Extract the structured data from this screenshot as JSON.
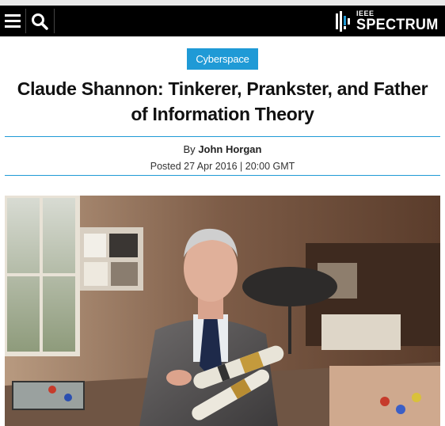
{
  "nav": {
    "menu_icon": "hamburger-menu-icon",
    "search_icon": "search-icon",
    "logo_small": "IEEE",
    "logo_big": "SPECTRUM"
  },
  "article": {
    "category": "Cyberspace",
    "title": "Claude Shannon: Tinkerer, Prankster, and Father of Information Theory",
    "by_prefix": "By",
    "author": "John Horgan",
    "posted": "Posted 27 Apr 2016 | 20:00 GMT"
  },
  "colors": {
    "accent": "#1f9ad6",
    "navbar": "#000000"
  }
}
